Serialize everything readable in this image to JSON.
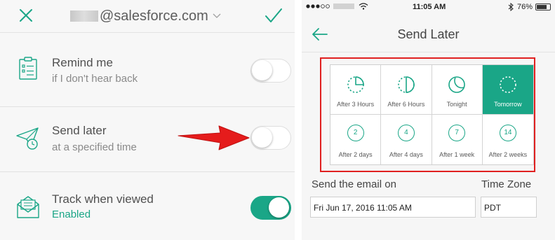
{
  "left": {
    "header": {
      "email": "@salesforce.com"
    },
    "rows": [
      {
        "title": "Remind me",
        "subtitle": "if I don't hear back",
        "toggle_on": false
      },
      {
        "title": "Send later",
        "subtitle": "at a specified time",
        "toggle_on": false
      },
      {
        "title": "Track when viewed",
        "subtitle": "Enabled",
        "toggle_on": true
      }
    ]
  },
  "right": {
    "status": {
      "time": "11:05 AM",
      "battery": "76%"
    },
    "title": "Send Later",
    "options": [
      {
        "label": "After 3 Hours",
        "icon": "clock-quarter-icon",
        "selected": false
      },
      {
        "label": "After 6 Hours",
        "icon": "clock-half-icon",
        "selected": false
      },
      {
        "label": "Tonight",
        "icon": "moon-icon",
        "selected": false
      },
      {
        "label": "Tomorrow",
        "icon": "sunrise-icon",
        "selected": true
      },
      {
        "label": "After 2 days",
        "badge": "2",
        "selected": false
      },
      {
        "label": "After 4 days",
        "badge": "4",
        "selected": false
      },
      {
        "label": "After 1 week",
        "badge": "7",
        "selected": false
      },
      {
        "label": "After 2 weeks",
        "badge": "14",
        "selected": false
      }
    ],
    "send_on_label": "Send the email on",
    "timezone_label": "Time Zone",
    "send_on_value": "Fri Jun 17, 2016 11:05 AM",
    "timezone_value": "PDT"
  },
  "colors": {
    "accent": "#1aa687",
    "highlight": "#e02020"
  }
}
